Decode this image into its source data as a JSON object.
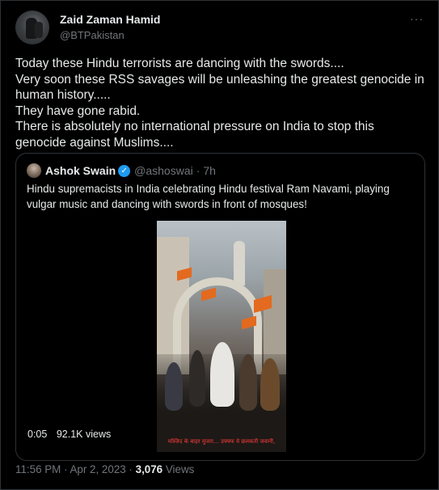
{
  "post": {
    "author_name": "Zaid Zaman Hamid",
    "author_handle": "@BTPakistan",
    "more_icon": "more-dots-icon",
    "more_glyph": "···",
    "text_lines": [
      "Today these Hindu terrorists are dancing with the swords....",
      "Very soon these RSS savages will be unleashing the greatest genocide in",
      "human history.....",
      "They have gone rabid.",
      "There is absolutely no international pressure on India to stop this",
      "genocide against Muslims...."
    ],
    "timestamp": "11:56 PM · Apr 2, 2023 · ",
    "views_count": "3,076",
    "views_label": " Views"
  },
  "quote": {
    "author_name": "Ashok Swain",
    "verified_icon": "verified-badge-icon",
    "verified_glyph": "✓",
    "author_handle": "@ashoswai",
    "separator": "·",
    "time": "7h",
    "text": "Hindu supremacists in India celebrating Hindu festival Ram Navami, playing vulgar music and dancing with swords in front of mosques!",
    "video": {
      "duration": "0:05",
      "views": "92.1K views",
      "caption": "मस्जिद के बाहर मुजरा... उफ्फ्फ ये छलकती जवानी,"
    }
  },
  "colors": {
    "background": "#000000",
    "text": "#e7e9ea",
    "secondary": "#71767b",
    "border": "#2f3336",
    "verified": "#1d9bf0"
  }
}
